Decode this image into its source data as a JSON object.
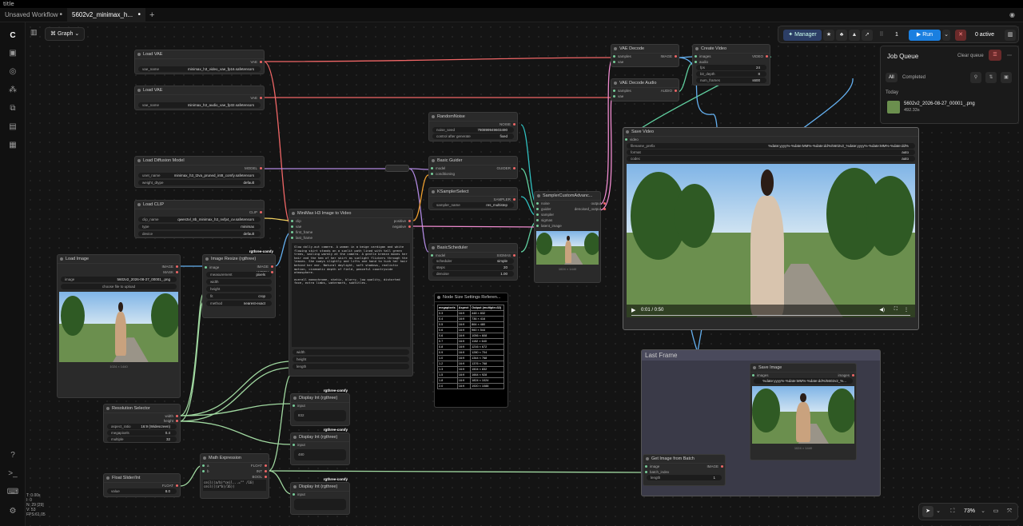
{
  "window": {
    "title": "title"
  },
  "tabs": [
    {
      "label": "Unsaved Workflow"
    },
    {
      "label": "5602v2_minimax_h..."
    }
  ],
  "topbar": {
    "graph_label": "Graph",
    "manager_label": "Manager",
    "queue_count": "1",
    "run_label": "Run",
    "active_label": "0 active"
  },
  "job_queue": {
    "title": "Job Queue",
    "clear_label": "Clear queue",
    "filter_all": "All",
    "filter_completed": "Completed",
    "section_today": "Today",
    "item_name": "5602v2_2026-08-27_00001_.png",
    "item_size": "492.33s"
  },
  "bottom": {
    "zoom": "73%"
  },
  "stats": {
    "lines": [
      "T: 0.00s",
      "I: 0",
      "N: 29 [29]",
      "V: 53",
      "FPS:61.05"
    ]
  },
  "nodes": {
    "load_vae_1": {
      "title": "Load VAE",
      "out": "VAE",
      "w_label": "vae_name",
      "w_value": "minimax_h3_video_vae_fp16.safetensors"
    },
    "load_vae_2": {
      "title": "Load VAE",
      "out": "VAE",
      "w_label": "vae_name",
      "w_value": "minimax_h3_audio_vae_fp32.safetensors"
    },
    "load_diff": {
      "title": "Load Diffusion Model",
      "out": "MODEL",
      "w1_label": "unet_name",
      "w1_value": "minimax_h3_t2va_pruned_int8_comfy.safetensors",
      "w2_label": "weight_dtype",
      "w2_value": "default"
    },
    "load_clip": {
      "title": "Load CLIP",
      "out": "CLIP",
      "w1_label": "clip_name",
      "w1_value": "qwen3vl_8b_minimax_h3_nvfp4_ov.safetensors",
      "w2_label": "type",
      "w2_value": "minimax",
      "w3_label": "device",
      "w3_value": "default"
    },
    "load_image": {
      "title": "Load Image",
      "out1": "IMAGE",
      "out2": "MASK",
      "w_label": "image",
      "w_value": "5602v2_2026-08-27_00001_.png",
      "btn": "choose file to upload",
      "caption": "1024 × 1440"
    },
    "image_resize": {
      "title": "Image Resize (rgthree)",
      "badge": "rgthree-comfy",
      "in": "image",
      "out1": "IMAGE",
      "out2": "WIDTH",
      "out3": "HEIGHT",
      "w1_label": "measurement",
      "w1_value": "pixels",
      "w2": "width",
      "w3": "height",
      "w4_label": "fit",
      "w4_value": "crop",
      "w5_label": "method",
      "w5_value": "nearest-exact"
    },
    "minimax": {
      "title": "MiniMax H3 Image to Video",
      "in1": "clip",
      "in2": "vae",
      "in3": "first_frame",
      "in4": "last_frame",
      "out1": "positive",
      "out2": "negative",
      "prompt": "Slow dolly-out camera. A woman in a beige cardigan and white flowing skirt stands on a sunlit path lined with tall green trees, smiling warmly at the camera. A gentle breeze moves her hair and the hem of her skirt as sunlight flickers through the leaves. She sways slightly and lifts one hand to tuck her hair behind her ear. Natural daylight, soft shadows, realistic motion, cinematic depth of field, peaceful countryside atmosphere.",
      "negative": "overall monochrome, static, blurry, low quality, distorted face, extra limbs, watermark, subtitles.",
      "w1": "width",
      "w2": "height",
      "w3": "length"
    },
    "random_noise": {
      "title": "RandomNoise",
      "out": "NOISE",
      "w1_label": "noise_seed",
      "w1_value": "780899949603490",
      "w2_label": "control after generate",
      "w2_value": "fixed"
    },
    "basic_guider": {
      "title": "Basic Guider",
      "in1": "model",
      "in2": "conditioning",
      "out": "GUIDER"
    },
    "ksampler_select": {
      "title": "KSamplerSelect",
      "out": "SAMPLER",
      "w_label": "sampler_name",
      "w_value": "res_multistep"
    },
    "basic_scheduler": {
      "title": "BasicScheduler",
      "in": "model",
      "out": "SIGMAS",
      "w1_label": "scheduler",
      "w1_value": "simple",
      "w2_label": "steps",
      "w2_value": "20",
      "w3_label": "denoise",
      "w3_value": "1.00"
    },
    "sampler_custom": {
      "title": "SamplerCustomAdvanc...",
      "in1": "noise",
      "in2": "guider",
      "in3": "sampler",
      "in4": "sigmas",
      "in5": "latent_image",
      "out1": "output",
      "out2": "denoised_output",
      "caption": "1024 × 1440"
    },
    "vae_decode": {
      "title": "VAE Decode",
      "in1": "samples",
      "in2": "vae",
      "out": "IMAGE"
    },
    "vae_decode_audio": {
      "title": "VAE Decode Audio",
      "in1": "samples",
      "in2": "vae",
      "out": "AUDIO"
    },
    "create_video": {
      "title": "Create Video",
      "in1": "images",
      "in2": "audio",
      "out": "VIDEO",
      "w1_label": "fps",
      "w1_value": "24",
      "w2_label": "bit_depth",
      "w2_value": "8",
      "w3_label": "num_frames",
      "w3_value": "s600"
    },
    "save_video": {
      "title": "Save Video",
      "in": "video",
      "w1_label": "filename_prefix",
      "w1_value": "%date:yyyy%-%date:MM%-%date:dd%/5602v2_%date:yyyy%-%date:MM%-%date:dd%",
      "w2_label": "format",
      "w2_value": "auto",
      "w3_label": "codec",
      "w3_value": "auto",
      "time": "0:01 / 0:50"
    },
    "node_size": {
      "title": "Node Size Settings Referen...",
      "headers": [
        "megapixels",
        "Aspect",
        "Output (multiple=32)"
      ],
      "rows": [
        [
          "0.3",
          "16:9",
          "448 × 832"
        ],
        [
          "0.4",
          "16:9",
          "736 × 416"
        ],
        [
          "0.5",
          "16:9",
          "864 × 480"
        ],
        [
          "0.6",
          "16:9",
          "960 × 544"
        ],
        [
          "0.6",
          "16:9",
          "1056 × 608"
        ],
        [
          "0.7",
          "16:9",
          "1152 × 640"
        ],
        [
          "0.8",
          "16:9",
          "1216 × 672"
        ],
        [
          "0.9",
          "16:9",
          "1280 × 704"
        ],
        [
          "1.0",
          "16:9",
          "1344 × 768"
        ],
        [
          "1.2",
          "16:9",
          "1376 × 768"
        ],
        [
          "1.3",
          "16:9",
          "1504 × 832"
        ],
        [
          "1.5",
          "16:9",
          "1664 × 928"
        ],
        [
          "1.8",
          "16:9",
          "1824 × 1024"
        ],
        [
          "2.0",
          "16:9",
          "1920 × 1088"
        ]
      ]
    },
    "resolution": {
      "title": "Resolution Selector",
      "out1": "width",
      "out2": "height",
      "w1_label": "aspect_ratio",
      "w1_value": "16:9 (Widescreen)",
      "w2_label": "megapixels",
      "w2_value": "0.4",
      "w3_label": "multiple",
      "w3_value": "32"
    },
    "float_slider": {
      "title": "Float Slider/Int",
      "out": "FLOAT",
      "w_label": "value",
      "w_value": "8.0"
    },
    "math_expr": {
      "title": "Math Expression",
      "in1": "a",
      "in2": "b",
      "out1": "FLOAT",
      "out2": "INT",
      "out3": "BOOL",
      "expr": "ceil((a/b)*ceil...=\"\" /16)",
      "result": "ceil(((a*b)/16))"
    },
    "display_1": {
      "title": "Display Int (rgthree)",
      "badge": "rgthree-comfy",
      "in": "input",
      "value": "832"
    },
    "display_2": {
      "title": "Display Int (rgthree)",
      "badge": "rgthree-comfy",
      "in": "input",
      "value": "480"
    },
    "display_3": {
      "title": "Display Int (rgthree)",
      "badge": "rgthree-comfy",
      "in": "input",
      "value": ""
    },
    "last_frame_group": {
      "title": "Last Frame"
    },
    "save_image": {
      "title": "Save Image",
      "in": "images",
      "out": "images",
      "w_value": "%date:yyyy%-%date:MM%-%date:dd%/5602v2_%...",
      "caption": "1024 × 1440"
    },
    "get_image_batch": {
      "title": "Get Image from Batch",
      "in1": "image",
      "in2": "batch_index",
      "out": "IMAGE",
      "w_label": "length",
      "w_value": "1"
    }
  }
}
